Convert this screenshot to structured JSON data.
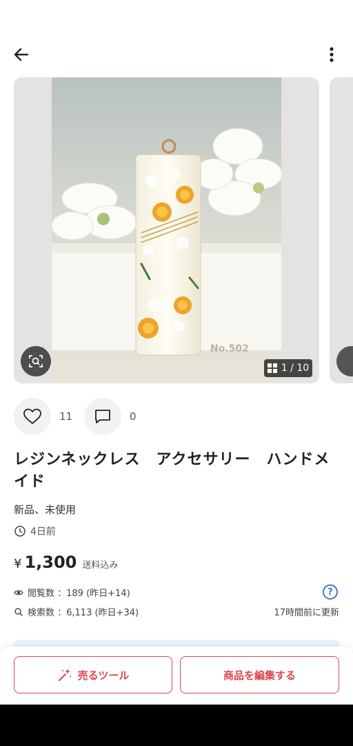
{
  "header": {
    "back_icon": "arrow-left-icon",
    "more_icon": "more-vertical-icon"
  },
  "gallery": {
    "image_description": "resin pendant with yellow and white pressed flowers",
    "watermark": "No.502",
    "counter": "1 / 10",
    "lens_icon": "image-search-icon"
  },
  "reactions": {
    "likes": "11",
    "comments": "0"
  },
  "item": {
    "title": "レジンネックレス　アクセサリー　ハンドメイド",
    "condition": "新品、未使用",
    "posted": "4日前",
    "currency": "¥",
    "price": "1,300",
    "shipping": "送料込み"
  },
  "stats": {
    "views": "閲覧数 ：189 (昨日+14)",
    "searches": "検索数 ：6,113 (昨日+34)",
    "updated": "17時間前に更新"
  },
  "bottom": {
    "sell_tool": "売るツール",
    "edit_item": "商品を編集する"
  },
  "colors": {
    "accent": "#e0434b",
    "help_blue": "#3a7bd5"
  }
}
